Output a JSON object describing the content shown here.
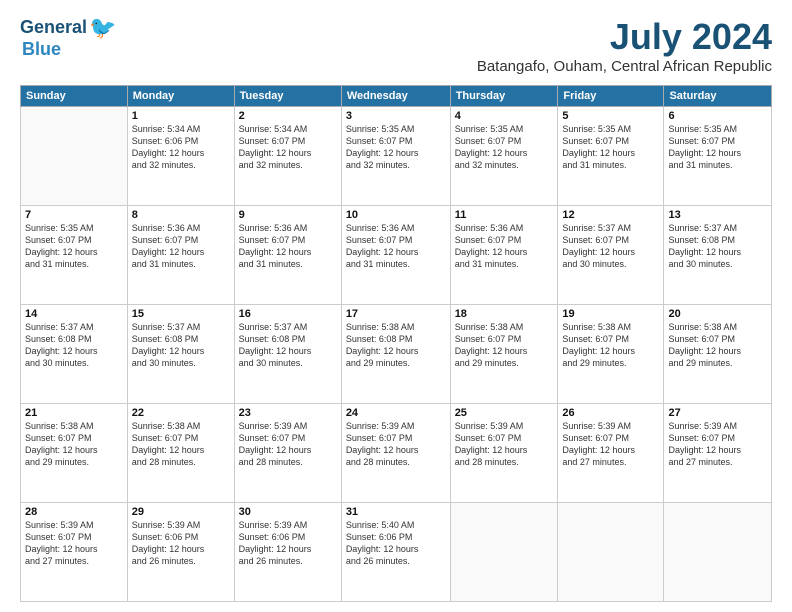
{
  "header": {
    "logo_line1": "General",
    "logo_line2": "Blue",
    "month": "July 2024",
    "location": "Batangafo, Ouham, Central African Republic"
  },
  "columns": [
    "Sunday",
    "Monday",
    "Tuesday",
    "Wednesday",
    "Thursday",
    "Friday",
    "Saturday"
  ],
  "weeks": [
    [
      {
        "day": "",
        "info": ""
      },
      {
        "day": "1",
        "info": "Sunrise: 5:34 AM\nSunset: 6:06 PM\nDaylight: 12 hours\nand 32 minutes."
      },
      {
        "day": "2",
        "info": "Sunrise: 5:34 AM\nSunset: 6:07 PM\nDaylight: 12 hours\nand 32 minutes."
      },
      {
        "day": "3",
        "info": "Sunrise: 5:35 AM\nSunset: 6:07 PM\nDaylight: 12 hours\nand 32 minutes."
      },
      {
        "day": "4",
        "info": "Sunrise: 5:35 AM\nSunset: 6:07 PM\nDaylight: 12 hours\nand 32 minutes."
      },
      {
        "day": "5",
        "info": "Sunrise: 5:35 AM\nSunset: 6:07 PM\nDaylight: 12 hours\nand 31 minutes."
      },
      {
        "day": "6",
        "info": "Sunrise: 5:35 AM\nSunset: 6:07 PM\nDaylight: 12 hours\nand 31 minutes."
      }
    ],
    [
      {
        "day": "7",
        "info": "Sunrise: 5:35 AM\nSunset: 6:07 PM\nDaylight: 12 hours\nand 31 minutes."
      },
      {
        "day": "8",
        "info": "Sunrise: 5:36 AM\nSunset: 6:07 PM\nDaylight: 12 hours\nand 31 minutes."
      },
      {
        "day": "9",
        "info": "Sunrise: 5:36 AM\nSunset: 6:07 PM\nDaylight: 12 hours\nand 31 minutes."
      },
      {
        "day": "10",
        "info": "Sunrise: 5:36 AM\nSunset: 6:07 PM\nDaylight: 12 hours\nand 31 minutes."
      },
      {
        "day": "11",
        "info": "Sunrise: 5:36 AM\nSunset: 6:07 PM\nDaylight: 12 hours\nand 31 minutes."
      },
      {
        "day": "12",
        "info": "Sunrise: 5:37 AM\nSunset: 6:07 PM\nDaylight: 12 hours\nand 30 minutes."
      },
      {
        "day": "13",
        "info": "Sunrise: 5:37 AM\nSunset: 6:08 PM\nDaylight: 12 hours\nand 30 minutes."
      }
    ],
    [
      {
        "day": "14",
        "info": "Sunrise: 5:37 AM\nSunset: 6:08 PM\nDaylight: 12 hours\nand 30 minutes."
      },
      {
        "day": "15",
        "info": "Sunrise: 5:37 AM\nSunset: 6:08 PM\nDaylight: 12 hours\nand 30 minutes."
      },
      {
        "day": "16",
        "info": "Sunrise: 5:37 AM\nSunset: 6:08 PM\nDaylight: 12 hours\nand 30 minutes."
      },
      {
        "day": "17",
        "info": "Sunrise: 5:38 AM\nSunset: 6:08 PM\nDaylight: 12 hours\nand 29 minutes."
      },
      {
        "day": "18",
        "info": "Sunrise: 5:38 AM\nSunset: 6:07 PM\nDaylight: 12 hours\nand 29 minutes."
      },
      {
        "day": "19",
        "info": "Sunrise: 5:38 AM\nSunset: 6:07 PM\nDaylight: 12 hours\nand 29 minutes."
      },
      {
        "day": "20",
        "info": "Sunrise: 5:38 AM\nSunset: 6:07 PM\nDaylight: 12 hours\nand 29 minutes."
      }
    ],
    [
      {
        "day": "21",
        "info": "Sunrise: 5:38 AM\nSunset: 6:07 PM\nDaylight: 12 hours\nand 29 minutes."
      },
      {
        "day": "22",
        "info": "Sunrise: 5:38 AM\nSunset: 6:07 PM\nDaylight: 12 hours\nand 28 minutes."
      },
      {
        "day": "23",
        "info": "Sunrise: 5:39 AM\nSunset: 6:07 PM\nDaylight: 12 hours\nand 28 minutes."
      },
      {
        "day": "24",
        "info": "Sunrise: 5:39 AM\nSunset: 6:07 PM\nDaylight: 12 hours\nand 28 minutes."
      },
      {
        "day": "25",
        "info": "Sunrise: 5:39 AM\nSunset: 6:07 PM\nDaylight: 12 hours\nand 28 minutes."
      },
      {
        "day": "26",
        "info": "Sunrise: 5:39 AM\nSunset: 6:07 PM\nDaylight: 12 hours\nand 27 minutes."
      },
      {
        "day": "27",
        "info": "Sunrise: 5:39 AM\nSunset: 6:07 PM\nDaylight: 12 hours\nand 27 minutes."
      }
    ],
    [
      {
        "day": "28",
        "info": "Sunrise: 5:39 AM\nSunset: 6:07 PM\nDaylight: 12 hours\nand 27 minutes."
      },
      {
        "day": "29",
        "info": "Sunrise: 5:39 AM\nSunset: 6:06 PM\nDaylight: 12 hours\nand 26 minutes."
      },
      {
        "day": "30",
        "info": "Sunrise: 5:39 AM\nSunset: 6:06 PM\nDaylight: 12 hours\nand 26 minutes."
      },
      {
        "day": "31",
        "info": "Sunrise: 5:40 AM\nSunset: 6:06 PM\nDaylight: 12 hours\nand 26 minutes."
      },
      {
        "day": "",
        "info": ""
      },
      {
        "day": "",
        "info": ""
      },
      {
        "day": "",
        "info": ""
      }
    ]
  ]
}
